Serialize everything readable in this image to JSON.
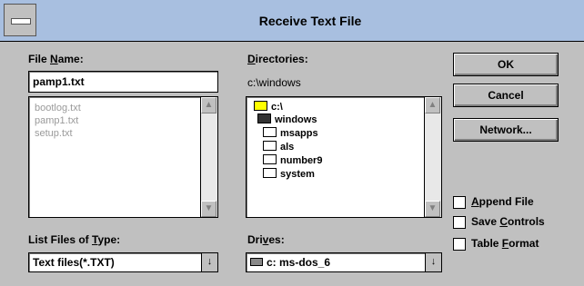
{
  "window": {
    "title": "Receive Text File"
  },
  "file_name": {
    "label_pre": "File ",
    "label_key": "N",
    "label_post": "ame:",
    "value": "pamp1.txt",
    "files": [
      "bootlog.txt",
      "pamp1.txt",
      "setup.txt"
    ]
  },
  "directories": {
    "label_key": "D",
    "label_post": "irectories:",
    "current": "c:\\windows",
    "items": [
      {
        "name": "c:\\",
        "icon": "folder-open-icon"
      },
      {
        "name": "windows",
        "icon": "folder-open-icon"
      },
      {
        "name": "msapps",
        "icon": "folder-icon"
      },
      {
        "name": "als",
        "icon": "folder-icon"
      },
      {
        "name": "number9",
        "icon": "folder-icon"
      },
      {
        "name": "system",
        "icon": "folder-icon"
      }
    ]
  },
  "file_type": {
    "label_pre": "List Files of ",
    "label_key": "T",
    "label_post": "ype:",
    "value": "Text files(*.TXT)"
  },
  "drives": {
    "label_pre": "Dri",
    "label_key": "v",
    "label_post": "es:",
    "value": "c: ms-dos_6"
  },
  "buttons": {
    "ok": "OK",
    "cancel": "Cancel",
    "network": "Network..."
  },
  "options": [
    {
      "key": "A",
      "rest": "ppend File",
      "checked": false
    },
    {
      "key": "",
      "pre": "Save ",
      "keychar": "C",
      "rest": "ontrols",
      "checked": false
    },
    {
      "key": "",
      "pre": "Table ",
      "keychar": "F",
      "rest": "ormat",
      "checked": false
    }
  ],
  "arrows": {
    "up": "▲",
    "down": "▼",
    "combo": "↓"
  }
}
